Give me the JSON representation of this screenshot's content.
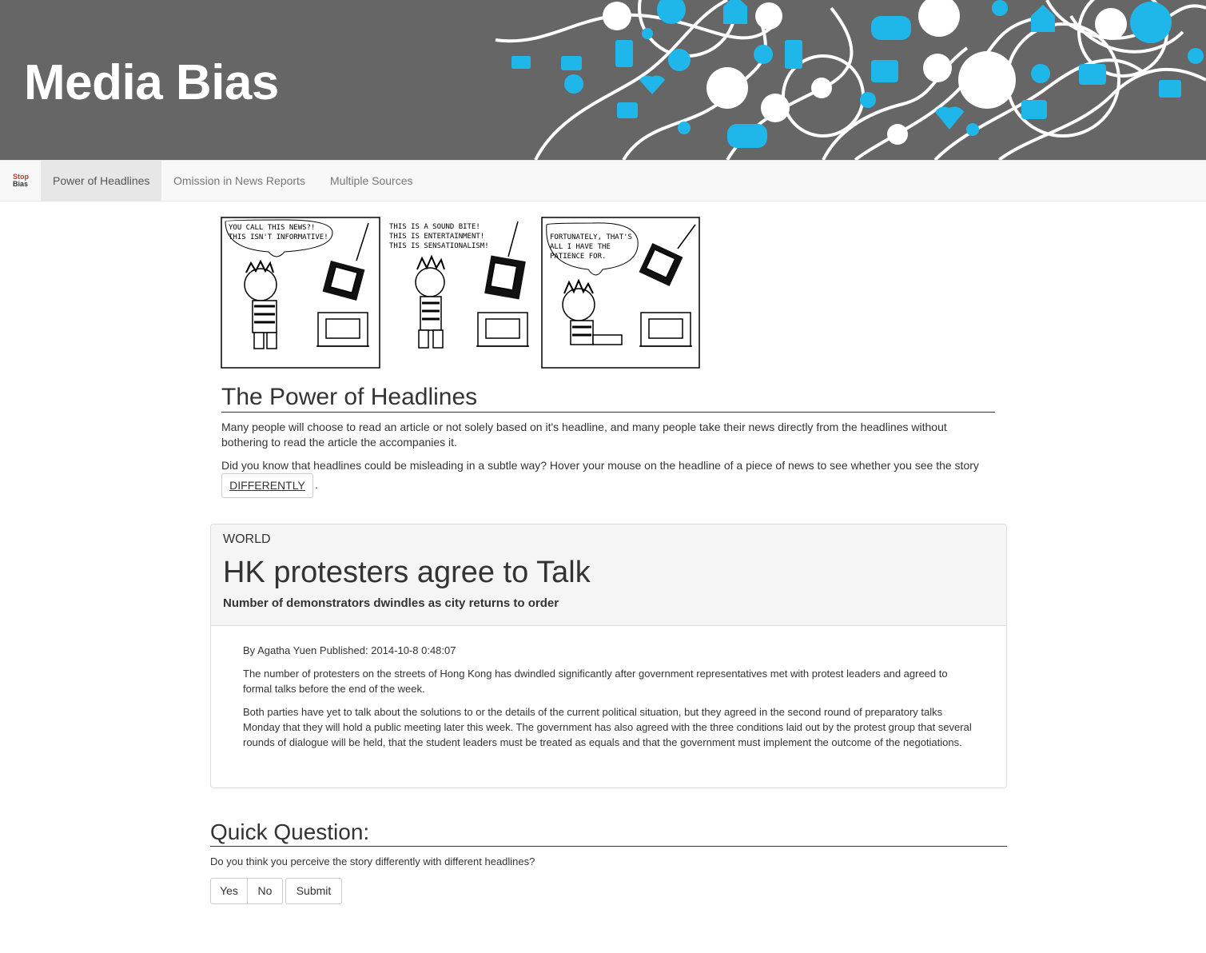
{
  "header": {
    "title": "Media Bias",
    "accent_color": "#1fb7ea",
    "background": "#666666"
  },
  "navbar": {
    "brand_line1": "Stop",
    "brand_line2": "Bias",
    "items": [
      {
        "label": "Power of Headlines",
        "active": true
      },
      {
        "label": "Omission in News Reports",
        "active": false
      },
      {
        "label": "Multiple Sources",
        "active": false
      }
    ]
  },
  "comic": {
    "panels": [
      {
        "speech": [
          "YOU CALL THIS NEWS?!",
          "THIS ISN'T INFORMATIVE!"
        ]
      },
      {
        "speech": [
          "THIS IS A SOUND BITE!",
          "THIS IS ENTERTAINMENT!",
          "THIS IS SENSATIONALISM!"
        ]
      },
      {
        "speech": [
          "FORTUNATELY, THAT'S",
          "ALL I HAVE THE",
          "PATIENCE FOR."
        ]
      }
    ]
  },
  "power_section": {
    "heading": "The Power of Headlines",
    "paragraph1": "Many people will choose to read an article or not solely based on it's headline, and many people take their news directly from the headlines without bothering to read the article the accompanies it.",
    "paragraph2": "Did you know that headlines could be misleading in a subtle way? Hover your mouse on the headline of a piece of news to see whether you see the story",
    "button_label": "DIFFERENTLY",
    "trailing": "."
  },
  "news": {
    "category": "WORLD",
    "headline": "HK protesters agree to Talk",
    "subheadline": "Number of demonstrators dwindles as city returns to order",
    "byline": "By Agatha Yuen Published: 2014-10-8 0:48:07",
    "paragraphs": [
      "The number of protesters on the streets of Hong Kong has dwindled significantly after government representatives met with protest leaders and agreed to formal talks before the end of the week.",
      "Both parties have yet to talk about the solutions to or the details of the current political situation, but they agreed in the second round of preparatory talks Monday that they will hold a public meeting later this week. The government has also agreed with the three conditions laid out by the protest group that several rounds of dialogue will be held, that the student leaders must be treated as equals and that the government must implement the outcome of the negotiations."
    ]
  },
  "quick_question": {
    "heading": "Quick Question:",
    "question": "Do you think you perceive the story differently with different headlines?",
    "yes_label": "Yes",
    "no_label": "No",
    "submit_label": "Submit"
  }
}
